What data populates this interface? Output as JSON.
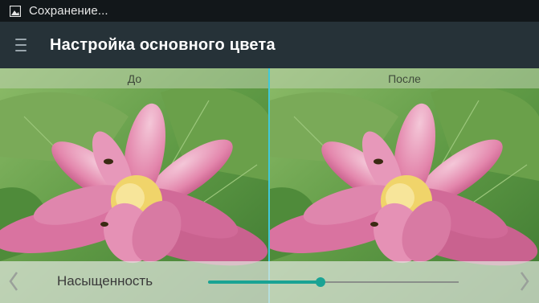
{
  "status_bar": {
    "text": "Сохранение...",
    "icon": "image-icon"
  },
  "app_bar": {
    "title": "Настройка основного цвета",
    "menu_icon": "menu-icon"
  },
  "preview": {
    "before_label": "До",
    "after_label": "После",
    "image_subject": "pink lotus flower with bee"
  },
  "controls": {
    "parameter_label": "Насыщенность",
    "slider_value": 0.45,
    "prev_icon": "chevron-left-icon",
    "next_icon": "chevron-right-icon"
  },
  "colors": {
    "accent": "#1aa394",
    "divider": "#40c9d8",
    "appbar": "#263238"
  }
}
